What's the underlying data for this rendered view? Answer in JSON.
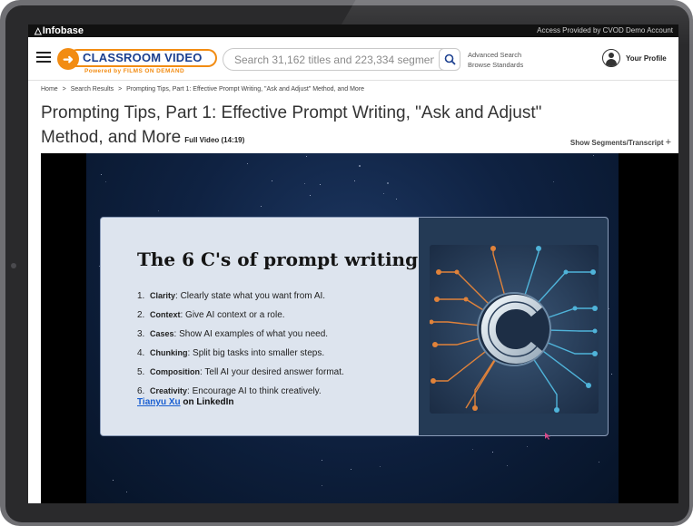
{
  "topbar": {
    "logo": "Infobase",
    "access_text": "Access Provided by CVOD Demo Account"
  },
  "header": {
    "brand_title": "CLASSROOM VIDEO",
    "brand_subtitle": "Powered by FILMS ON DEMAND",
    "search_placeholder": "Search 31,162 titles and 223,334 segments",
    "advanced_search": "Advanced Search",
    "browse_standards": "Browse Standards",
    "profile_label": "Your Profile"
  },
  "breadcrumb": {
    "items": [
      "Home",
      ">",
      "Search Results",
      ">",
      "Prompting Tips, Part 1: Effective Prompt Writing, \"Ask and Adjust\" Method, and More"
    ]
  },
  "page": {
    "title": "Prompting Tips, Part 1: Effective Prompt Writing, \"Ask and Adjust\" Method, and More",
    "full_video": "Full Video (14:19)",
    "show_segments": "Show Segments/Transcript",
    "show_segments_icon": "plus-icon"
  },
  "slide": {
    "heading": "The 6 C's of prompt writing",
    "items": [
      {
        "num": "1.",
        "term": "Clarity",
        "text": ": Clearly state what you want from AI."
      },
      {
        "num": "2.",
        "term": "Context",
        "text": ": Give AI context or a role."
      },
      {
        "num": "3.",
        "term": "Cases",
        "text": ": Show AI examples of what you need."
      },
      {
        "num": "4.",
        "term": "Chunking",
        "text": ": Split big tasks into smaller steps."
      },
      {
        "num": "5.",
        "term": "Composition",
        "text": ": Tell AI your desired answer format."
      },
      {
        "num": "6.",
        "term": "Creativity",
        "text": ": Encourage AI to think creatively."
      }
    ],
    "credit_name": "Tianyu Xu",
    "credit_rest": " on LinkedIn"
  },
  "colors": {
    "brand_orange": "#f28c13",
    "brand_blue": "#1b3f8f",
    "link_blue": "#1a5fd1"
  }
}
